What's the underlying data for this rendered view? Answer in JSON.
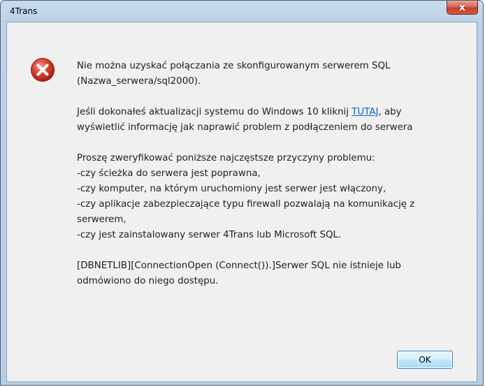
{
  "window": {
    "title": "4Trans",
    "close_label": "x"
  },
  "message": {
    "p1": [
      "Nie można uzyskać połączania ze skonfigurowanym serwerem SQL",
      "(Nazwa_serwera/sql2000)."
    ],
    "p2": {
      "before_link": "Jeśli dokonałeś aktualizacji systemu do Windows 10 kliknij ",
      "link_text": "TUTAJ",
      "after_link": ", aby",
      "line2": "wyświetlić informację jak naprawić problem z podłączeniem do serwera"
    },
    "p3": [
      "Proszę zweryfikować poniższe najczęstsze przyczyny problemu:",
      "-czy ścieżka do serwera jest poprawna,",
      "-czy komputer, na którym uruchomiony jest serwer jest włączony,",
      "-czy aplikacje zabezpieczające typu firewall pozwalają na komunikację z",
      "serwerem,",
      "-czy jest zainstalowany serwer 4Trans lub Microsoft SQL."
    ],
    "p4": [
      "[DBNETLIB][ConnectionOpen (Connect()).]Serwer SQL nie istnieje lub",
      "odmówiono do niego dostępu."
    ]
  },
  "buttons": {
    "ok_label": "OK"
  },
  "icons": {
    "error": "error-icon",
    "close": "close-icon"
  },
  "colors": {
    "link": "#0066cc",
    "error_red": "#d6372a",
    "close_red": "#c7402d"
  }
}
